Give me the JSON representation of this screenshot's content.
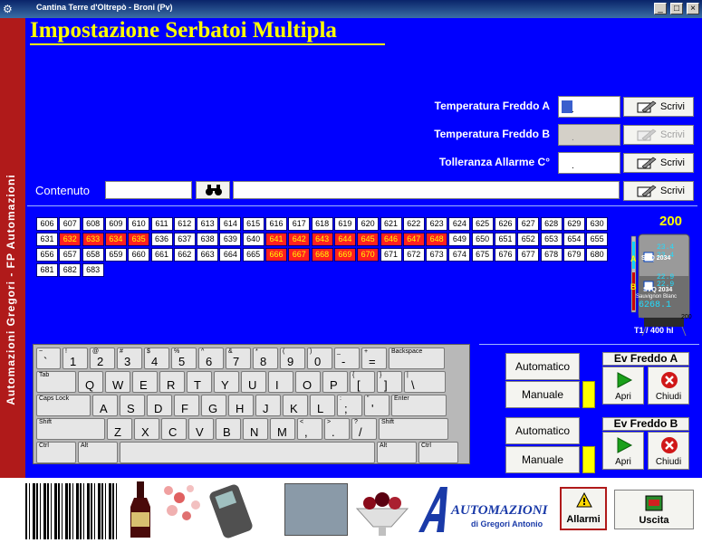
{
  "window": {
    "title": "Cantina Terre d'Oltrepò - Broni (Pv)"
  },
  "sidebar": {
    "text": "Automazioni Gregori - FP Automazioni"
  },
  "page_title": "Impostazione Serbatoi Multipla",
  "settings": {
    "temp_freddo_a": {
      "label": "Temperatura Freddo A",
      "value": ".",
      "button": "Scrivi"
    },
    "temp_freddo_b": {
      "label": "Temperatura Freddo B",
      "value": ".",
      "button": "Scrivi"
    },
    "tolleranza": {
      "label": "Tolleranza Allarme C°",
      "value": ".",
      "button": "Scrivi"
    },
    "contenuto": {
      "label": "Contenuto",
      "value": "",
      "text": "",
      "button": "Scrivi"
    }
  },
  "tanks": {
    "numbers": [
      606,
      607,
      608,
      609,
      610,
      611,
      612,
      613,
      614,
      615,
      616,
      617,
      618,
      619,
      620,
      621,
      622,
      623,
      624,
      625,
      626,
      627,
      628,
      629,
      630,
      631,
      632,
      633,
      634,
      635,
      636,
      637,
      638,
      639,
      640,
      641,
      642,
      643,
      644,
      645,
      646,
      647,
      648,
      649,
      650,
      651,
      652,
      653,
      654,
      655,
      656,
      657,
      658,
      659,
      660,
      661,
      662,
      663,
      664,
      665,
      666,
      667,
      668,
      669,
      670,
      671,
      672,
      673,
      674,
      675,
      676,
      677,
      678,
      679,
      680,
      681,
      682,
      683
    ],
    "selected": [
      632,
      633,
      634,
      635,
      641,
      642,
      643,
      644,
      645,
      646,
      647,
      648,
      666,
      667,
      668,
      669,
      670
    ]
  },
  "tank_widget": {
    "number": "200",
    "label_a": "A",
    "label_b": "B",
    "temp_a1": "23.4",
    "temp_a2": "23.4",
    "temp_b1": "22.9",
    "temp_b2": "22.9",
    "code": "SVQ 2034",
    "code2": "SVQ 2034",
    "wine": "Sauvignon Blanc",
    "volume_display": "6268.1",
    "scale_max": "200",
    "caption": "T1 / 400 hl"
  },
  "keyboard": {
    "row1": [
      [
        "~",
        "`"
      ],
      [
        "!",
        "1"
      ],
      [
        "@",
        "2"
      ],
      [
        "#",
        "3"
      ],
      [
        "$",
        "4"
      ],
      [
        "%",
        "5"
      ],
      [
        "^",
        "6"
      ],
      [
        "&",
        "7"
      ],
      [
        "*",
        "8"
      ],
      [
        "(",
        "9"
      ],
      [
        ")",
        "0"
      ],
      [
        "_",
        "-"
      ],
      [
        "+",
        "="
      ],
      [
        "Backspace",
        ""
      ]
    ],
    "row2": [
      [
        "Tab",
        ""
      ],
      [
        "",
        "Q"
      ],
      [
        "",
        "W"
      ],
      [
        "",
        "E"
      ],
      [
        "",
        "R"
      ],
      [
        "",
        "T"
      ],
      [
        "",
        "Y"
      ],
      [
        "",
        "U"
      ],
      [
        "",
        "I"
      ],
      [
        "",
        "O"
      ],
      [
        "",
        "P"
      ],
      [
        "{",
        "["
      ],
      [
        "}",
        "]"
      ],
      [
        "|",
        "\\"
      ]
    ],
    "row3": [
      [
        "Caps Lock",
        ""
      ],
      [
        "",
        "A"
      ],
      [
        "",
        "S"
      ],
      [
        "",
        "D"
      ],
      [
        "",
        "F"
      ],
      [
        "",
        "G"
      ],
      [
        "",
        "H"
      ],
      [
        "",
        "J"
      ],
      [
        "",
        "K"
      ],
      [
        "",
        "L"
      ],
      [
        ":",
        ";"
      ],
      [
        "\"",
        "'"
      ],
      [
        "Enter",
        ""
      ]
    ],
    "row4": [
      [
        "Shift",
        ""
      ],
      [
        "",
        "Z"
      ],
      [
        "",
        "X"
      ],
      [
        "",
        "C"
      ],
      [
        "",
        "V"
      ],
      [
        "",
        "B"
      ],
      [
        "",
        "N"
      ],
      [
        "",
        "M"
      ],
      [
        "<",
        ","
      ],
      [
        ">",
        "."
      ],
      [
        "?",
        "/"
      ],
      [
        "Shift",
        ""
      ]
    ],
    "row5": [
      [
        "Ctrl",
        ""
      ],
      [
        "Alt",
        ""
      ],
      [
        "",
        ""
      ],
      [
        "Alt",
        ""
      ],
      [
        "Ctrl",
        ""
      ]
    ]
  },
  "controls": {
    "automatico_label": "Automatico",
    "manuale_label": "Manuale",
    "ev_a": "Ev Freddo A",
    "ev_b": "Ev Freddo B",
    "apri": "Apri",
    "chiudi": "Chiudi"
  },
  "footer": {
    "brand": "AUTOMAZIONI",
    "brand_sub": "di Gregori Antonio",
    "allarmi": "Allarmi",
    "uscita": "Uscita"
  },
  "colors": {
    "panel": "#0000ff",
    "title": "#ffff00",
    "selected_cell": "#ff2020",
    "strip": "#b01a1a"
  }
}
